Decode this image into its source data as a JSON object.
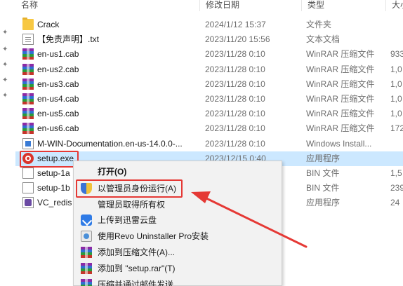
{
  "header": {
    "col_name": "名称",
    "col_date": "修改日期",
    "col_type": "类型",
    "col_size": "大小"
  },
  "files": [
    {
      "name": "Crack",
      "date": "2024/1/12 15:37",
      "type": "文件夹",
      "size": "",
      "icon": "folder-icon"
    },
    {
      "name": "【免责声明】.txt",
      "date": "2023/11/20 15:56",
      "type": "文本文档",
      "size": "",
      "icon": "text-file-icon"
    },
    {
      "name": "en-us1.cab",
      "date": "2023/11/28 0:10",
      "type": "WinRAR 压缩文件",
      "size": "933",
      "icon": "winrar-icon"
    },
    {
      "name": "en-us2.cab",
      "date": "2023/11/28 0:10",
      "type": "WinRAR 压缩文件",
      "size": "1,0",
      "icon": "winrar-icon"
    },
    {
      "name": "en-us3.cab",
      "date": "2023/11/28 0:10",
      "type": "WinRAR 压缩文件",
      "size": "1,0",
      "icon": "winrar-icon"
    },
    {
      "name": "en-us4.cab",
      "date": "2023/11/28 0:10",
      "type": "WinRAR 压缩文件",
      "size": "1,0",
      "icon": "winrar-icon"
    },
    {
      "name": "en-us5.cab",
      "date": "2023/11/28 0:10",
      "type": "WinRAR 压缩文件",
      "size": "1,0",
      "icon": "winrar-icon"
    },
    {
      "name": "en-us6.cab",
      "date": "2023/11/28 0:10",
      "type": "WinRAR 压缩文件",
      "size": "172",
      "icon": "winrar-icon"
    },
    {
      "name": "M-WIN-Documentation.en-us-14.0.0-...",
      "date": "2023/11/28 0:10",
      "type": "Windows Install...",
      "size": "",
      "icon": "installer-icon"
    },
    {
      "name": "setup.exe",
      "date": "2023/12/15 0:40",
      "type": "应用程序",
      "size": "",
      "icon": "setup-gear-icon"
    },
    {
      "name": "setup-1a",
      "date": "",
      "type": "BIN 文件",
      "size": "1,5",
      "icon": "bin-file-icon"
    },
    {
      "name": "setup-1b",
      "date": "",
      "type": "BIN 文件",
      "size": "239",
      "icon": "bin-file-icon"
    },
    {
      "name": "VC_redis",
      "date": "",
      "type": "应用程序",
      "size": "24",
      "icon": "vc-redist-icon"
    }
  ],
  "context_menu": {
    "items": [
      {
        "label": "打开(O)",
        "icon": ""
      },
      {
        "label": "以管理员身份运行(A)",
        "icon": "uac-shield-icon"
      },
      {
        "label": "管理员取得所有权",
        "icon": ""
      },
      {
        "label": "上传到迅雷云盘",
        "icon": "thunder-cloud-icon"
      },
      {
        "label": "使用Revo Uninstaller Pro安装",
        "icon": "revo-uninstaller-icon"
      },
      {
        "label": "添加到压缩文件(A)...",
        "icon": "winrar-icon"
      },
      {
        "label": "添加到 \"setup.rar\"(T)",
        "icon": "winrar-icon"
      },
      {
        "label": "压缩并通过邮件发送...",
        "icon": "winrar-icon"
      }
    ]
  },
  "colors": {
    "selection": "#cce8ff",
    "annotation_red": "#e53935"
  }
}
